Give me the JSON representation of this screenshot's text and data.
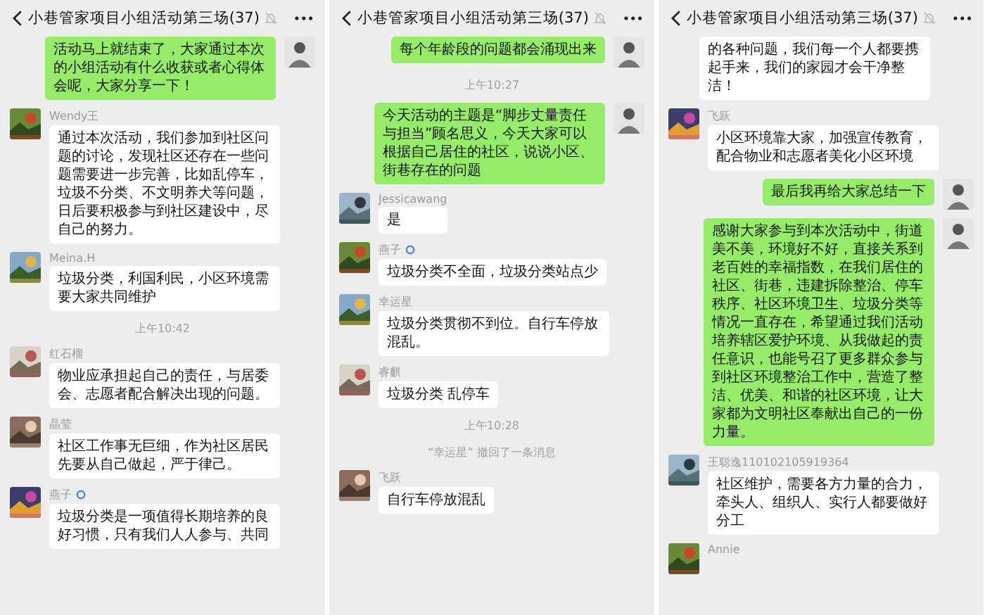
{
  "panels": [
    {
      "title": "小巷管家项目小组活动第三场(37)",
      "messages": [
        {
          "kind": "sent",
          "text": "活动马上就结束了，大家通过本次的小组活动有什么收获或者心得体会呢，大家分享一下！"
        },
        {
          "kind": "received",
          "sender": "Wendy王",
          "badge": false,
          "text": "通过本次活动，我们参加到社区问题的讨论，发现社区还存在一些问题需要进一步完善，比如乱停车，垃圾不分类、不文明养犬等问题，日后要积极参与到社区建设中，尽自己的努力。"
        },
        {
          "kind": "received",
          "sender": "Meina.H",
          "badge": false,
          "text": "垃圾分类，利国利民，小区环境需要大家共同维护"
        },
        {
          "kind": "time",
          "text": "上午10:42"
        },
        {
          "kind": "received",
          "sender": "红石榴",
          "badge": false,
          "text": "物业应承担起自己的责任，与居委会、志愿者配合解决出现的问题。"
        },
        {
          "kind": "received",
          "sender": "晶莹",
          "badge": false,
          "text": "社区工作事无巨细，作为社区居民先要从自己做起，严于律己。"
        },
        {
          "kind": "received",
          "sender": "燕子",
          "badge": true,
          "text": "垃圾分类是一项值得长期培养的良好习惯，只有我们人人参与、共同"
        }
      ]
    },
    {
      "title": "小巷管家项目小组活动第三场(37)",
      "messages": [
        {
          "kind": "sent",
          "text": "每个年龄段的问题都会涌现出来"
        },
        {
          "kind": "time",
          "text": "上午10:27"
        },
        {
          "kind": "sent",
          "text": "今天活动的主题是“脚步丈量责任与担当”顾名思义，今天大家可以根据自己居住的社区，说说小区、街巷存在的问题"
        },
        {
          "kind": "received",
          "sender": "Jessicawang",
          "badge": false,
          "text": "是"
        },
        {
          "kind": "received",
          "sender": "燕子",
          "badge": true,
          "text": "垃圾分类不全面，垃圾分类站点少"
        },
        {
          "kind": "received",
          "sender": "幸运星",
          "badge": false,
          "text": "垃圾分类贯彻不到位。自行车停放混乱。"
        },
        {
          "kind": "received",
          "sender": "睿麒",
          "badge": false,
          "text": "垃圾分类 乱停车"
        },
        {
          "kind": "time",
          "text": "上午10:28"
        },
        {
          "kind": "notice",
          "text": "“幸运星” 撤回了一条消息"
        },
        {
          "kind": "received",
          "sender": "飞跃",
          "badge": false,
          "text": "自行车停放混乱"
        }
      ]
    },
    {
      "title": "小巷管家项目小组活动第三场(37)",
      "messages": [
        {
          "kind": "continued",
          "text": "的各种问题，我们每一个人都要携起手来，我们的家园才会干净整洁！"
        },
        {
          "kind": "received",
          "sender": "飞跃",
          "badge": false,
          "text": "小区环境靠大家，加强宣传教育，配合物业和志愿者美化小区环境"
        },
        {
          "kind": "sent",
          "text": "最后我再给大家总结一下"
        },
        {
          "kind": "sent",
          "text": "感谢大家参与到本次活动中，街道美不美，环境好不好，直接关系到老百姓的幸福指数，在我们居住的社区、街巷，违建拆除整治、停车秩序、社区环境卫生、垃圾分类等情况一直存在，希望通过我们活动培养辖区爱护环境、从我做起的责任意识，也能号召了更多群众参与到社区环境整治工作中，营造了整洁、优美、和谐的社区环境，让大家都为文明社区奉献出自己的一份力量。"
        },
        {
          "kind": "received",
          "sender": "王聪逸110102105919364",
          "badge": false,
          "text": "社区维护，需要各方力量的合力，牵头人、组织人、实行人都要做好分工"
        },
        {
          "kind": "received",
          "sender": "Annie",
          "badge": false
        }
      ]
    }
  ]
}
